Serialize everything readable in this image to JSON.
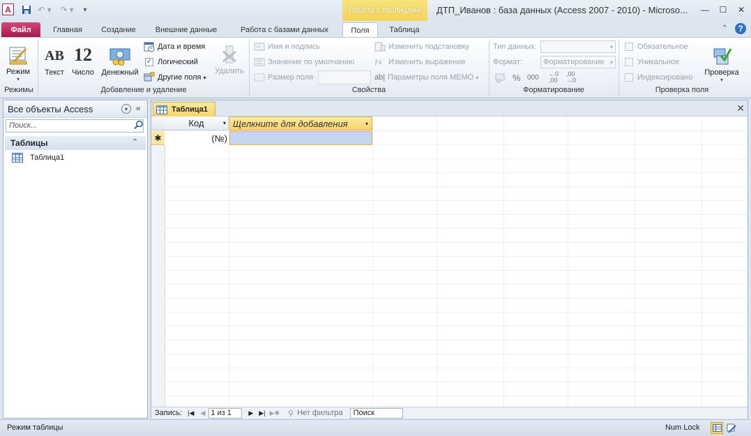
{
  "titlebar": {
    "app_icon_letter": "A",
    "context_group": "Работа с таблицами",
    "title": "ДТП_Иванов : база данных (Access 2007 - 2010)  -  Microso...",
    "minimize": "—",
    "maximize": "☐",
    "close": "✕"
  },
  "tabs": {
    "file": "Файл",
    "home": "Главная",
    "create": "Создание",
    "external": "Внешние данные",
    "database": "Работа с базами данных",
    "fields": "Поля",
    "table": "Таблица"
  },
  "ribbon": {
    "views": {
      "mode": "Режим",
      "label": "Режимы"
    },
    "addremove": {
      "text_icon": "AB",
      "text": "Текст",
      "number_icon": "12",
      "number": "Число",
      "currency": "Денежный",
      "datetime": "Дата и время",
      "logical": "Логический",
      "more_fields": "Другие поля",
      "delete": "Удалить",
      "label": "Добавление и удаление"
    },
    "properties": {
      "name_caption": "Имя и подпись",
      "default_value": "Значение по умолчанию",
      "field_size": "Размер поля",
      "change_lookup": "Изменить подстановку",
      "change_expression": "Изменить выражение",
      "memo_settings": "Параметры поля MEMO",
      "label": "Свойства"
    },
    "formatting": {
      "data_type": "Тип данных:",
      "format": "Формат:",
      "format_value": "Форматирование",
      "percent": "%",
      "thousands": "000",
      "label": "Форматирование"
    },
    "validation": {
      "required": "Обязательное",
      "unique": "Уникальное",
      "indexed": "Индексировано",
      "check": "Проверка",
      "label": "Проверка поля"
    }
  },
  "nav": {
    "title": "Все объекты Access",
    "search_placeholder": "Поиск...",
    "section": "Таблицы",
    "items": [
      "Таблица1"
    ]
  },
  "document": {
    "tab": "Таблица1",
    "columns": [
      "Код",
      "Щелкните для добавления"
    ],
    "new_row_marker": "✱",
    "new_row_id": "(№)"
  },
  "record_nav": {
    "label": "Запись:",
    "position": "1 из 1",
    "filter": "Нет фильтра",
    "search": "Поиск"
  },
  "status": {
    "mode": "Режим таблицы",
    "numlock": "Num Lock"
  },
  "colors": {
    "accent_file": "#b81c57",
    "context_tab": "#f3d35a",
    "selection": "#c5d6ee",
    "header_highlight": "#fbd56b"
  }
}
